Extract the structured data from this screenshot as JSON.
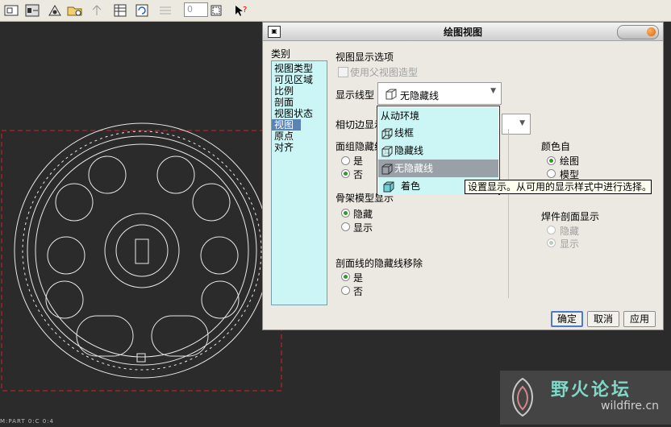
{
  "toolbar": {
    "zoom_input_value": "0",
    "icons": [
      "zoom-window-icon",
      "shaded-eye-icon",
      "open-folder-icon",
      "arrow-up-icon",
      "table-grid-icon",
      "refresh-icon",
      "list-icon",
      "frame-icon",
      "whats-this-icon"
    ]
  },
  "dialog": {
    "title": "绘图视图",
    "category_label": "类别",
    "categories": [
      "视图类型",
      "可见区域",
      "比例",
      "剖面",
      "视图状态",
      "视图显示",
      "原点",
      "对齐"
    ],
    "selected_category": "视图显示",
    "section_title": "视图显示选项",
    "use_parent_style_label": "使用父视图造型",
    "display_style_label": "显示线型",
    "display_style_value": "无隐藏线",
    "tangent_edge_label": "相切边显示",
    "face_hidden_label": "面组隐藏线",
    "face_hidden_options": [
      "是",
      "否"
    ],
    "skeleton_label": "骨架模型显示",
    "skeleton_options": [
      "隐藏",
      "显示"
    ],
    "section_hidden_label": "剖面线的隐藏线移除",
    "section_hidden_options": [
      "是",
      "否"
    ],
    "color_from_label": "颜色自",
    "color_from_options": [
      "绘图",
      "模型"
    ],
    "weld_section_label": "焊件剖面显示",
    "weld_section_options": [
      "隐藏",
      "显示"
    ],
    "dropdown_items": [
      "从动环境",
      "线框",
      "隐藏线",
      "无隐藏线",
      "着色"
    ],
    "dropdown_selected": "无隐藏线",
    "tooltip": "设置显示。从可用的显示样式中进行选择。",
    "buttons": {
      "ok": "确定",
      "cancel": "取消",
      "apply": "应用"
    }
  },
  "watermark": {
    "title": "野火论坛",
    "url": "wildfire.cn"
  },
  "colors": {
    "canvas": "#2b2b2b",
    "cad_line": "#e8e8e8",
    "frame_dash": "#d42020",
    "list_bg": "#ccf6f6",
    "selection": "#5a83b5"
  }
}
